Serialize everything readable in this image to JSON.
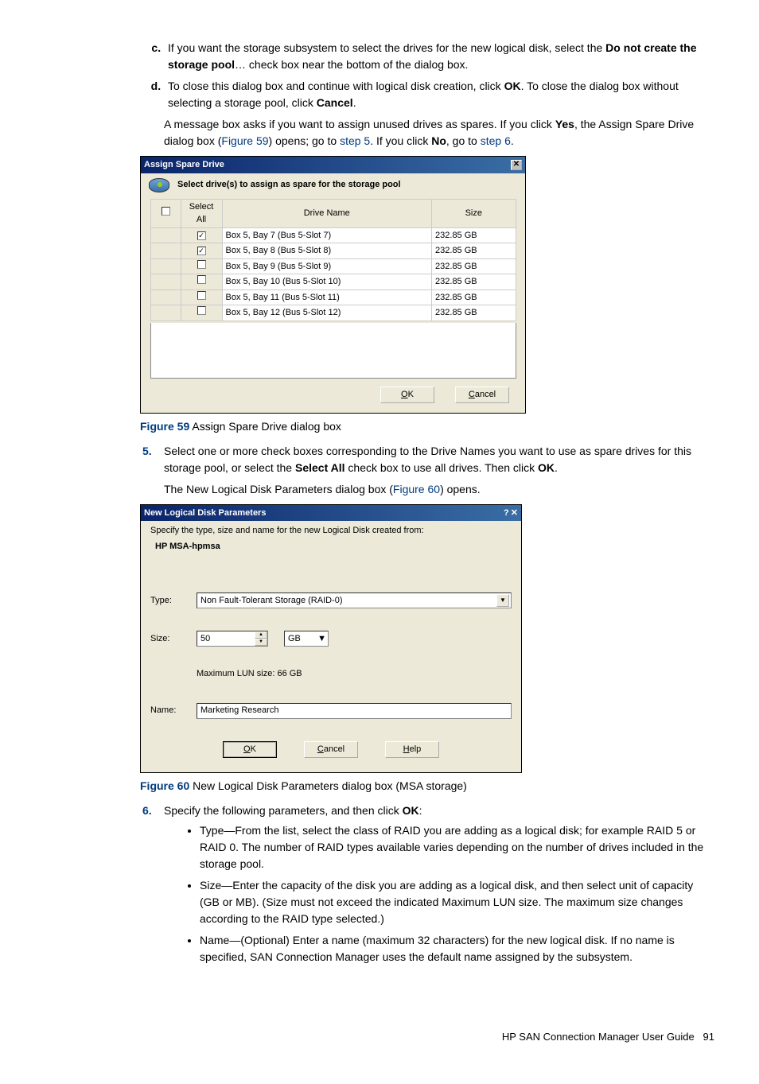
{
  "list_c": {
    "prefix": "If you want the storage subsystem to select the drives for the new logical disk, select the ",
    "bold": "Do not create the storage pool",
    "suffix": "… check box near the bottom of the dialog box."
  },
  "list_d": {
    "p1": "To close this dialog box and continue with logical disk creation, click ",
    "ok": "OK",
    "p2": ". To close the dialog box without selecting a storage pool, click ",
    "cancel": "Cancel",
    "p3": "."
  },
  "msg": {
    "p1": "A message box asks if you want to assign unused drives as spares. If you click ",
    "yes": "Yes",
    "p2": ", the Assign Spare Drive dialog box (",
    "fig59": "Figure 59",
    "p3": ") opens; go to ",
    "step5": "step 5",
    "p4": ". If you click ",
    "no": "No",
    "p5": ", go to ",
    "step6": "step 6",
    "p6": "."
  },
  "dialog1": {
    "title": "Assign Spare Drive",
    "subtitle": "Select drive(s) to assign as spare for the storage pool",
    "cols": {
      "selall": "Select All",
      "name": "Drive Name",
      "size": "Size"
    },
    "rows": [
      {
        "checked": true,
        "name": "Box 5, Bay 7 (Bus 5-Slot 7)",
        "size": "232.85 GB"
      },
      {
        "checked": true,
        "name": "Box 5, Bay 8 (Bus 5-Slot 8)",
        "size": "232.85 GB"
      },
      {
        "checked": false,
        "name": "Box 5, Bay 9 (Bus 5-Slot 9)",
        "size": "232.85 GB"
      },
      {
        "checked": false,
        "name": "Box 5, Bay 10 (Bus 5-Slot 10)",
        "size": "232.85 GB"
      },
      {
        "checked": false,
        "name": "Box 5, Bay 11 (Bus 5-Slot 11)",
        "size": "232.85 GB"
      },
      {
        "checked": false,
        "name": "Box 5, Bay 12 (Bus 5-Slot 12)",
        "size": "232.85 GB"
      }
    ],
    "ok": "OK",
    "cancel": "Cancel"
  },
  "fig59": {
    "label": "Figure 59",
    "caption": " Assign Spare Drive dialog box"
  },
  "step5": {
    "num": "5.",
    "p1": "Select one or more check boxes corresponding to the Drive Names you want to use as spare drives for this storage pool, or select the ",
    "selall": "Select All",
    "p2": " check box to use all drives. Then click ",
    "ok": "OK",
    "p3": ".",
    "para2a": "The New Logical Disk Parameters dialog box (",
    "fig60": "Figure 60",
    "para2b": ") opens."
  },
  "dialog2": {
    "title": "New Logical Disk Parameters",
    "instr": "Specify the type, size and name for the new Logical Disk created from:",
    "device": "HP MSA-hpmsa",
    "type_label": "Type:",
    "type_value": "Non Fault-Tolerant Storage (RAID-0)",
    "size_label": "Size:",
    "size_value": "50",
    "size_unit": "GB",
    "maxlun": "Maximum LUN size: 66 GB",
    "name_label": "Name:",
    "name_value": "Marketing Research",
    "ok": "OK",
    "cancel": "Cancel",
    "help": "Help"
  },
  "fig60": {
    "label": "Figure 60",
    "caption": " New Logical Disk Parameters dialog box (MSA storage)"
  },
  "step6": {
    "num": "6.",
    "p1": "Specify the following parameters, and then click ",
    "ok": "OK",
    "p2": ":",
    "b1": "Type—From the list, select the class of RAID you are adding as a logical disk; for example RAID 5 or RAID 0. The number of RAID types available varies depending on the number of drives included in the storage pool.",
    "b2": "Size—Enter the capacity of the disk you are adding as a logical disk, and then select unit of capacity (GB or MB). (Size must not exceed the indicated Maximum LUN size. The maximum size changes according to the RAID type selected.)",
    "b3": "Name—(Optional) Enter a name (maximum 32 characters) for the new logical disk. If no name is specified, SAN Connection Manager uses the default name assigned by the subsystem."
  },
  "footer": {
    "text": "HP SAN Connection Manager User Guide",
    "page": "91"
  }
}
